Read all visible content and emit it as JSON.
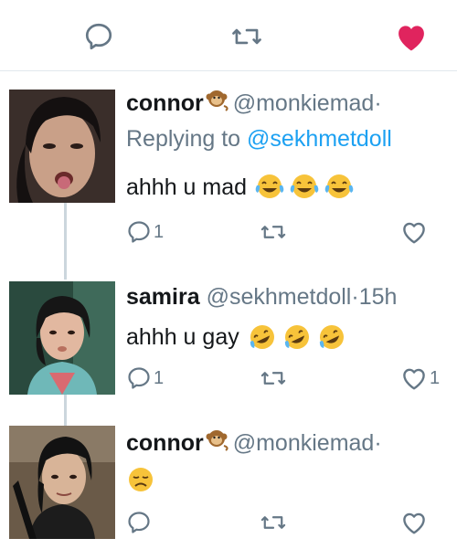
{
  "top_actions": {
    "reply_icon": "reply-icon",
    "retweet_icon": "retweet-icon",
    "like_icon": "heart-filled-icon",
    "like_color": "#e0245e"
  },
  "tweets": [
    {
      "name": "connor",
      "handle": "@monkiemad",
      "separator": "·",
      "time": "",
      "replying_prefix": "Replying to",
      "replying_to": "@sekhmetdoll",
      "text": "ahhh u mad",
      "emoji": "face-with-tears-of-joy",
      "reply_count": "1",
      "like_count": ""
    },
    {
      "name": "samira",
      "handle": "@sekhmetdoll",
      "separator": "·",
      "time": "15h",
      "text": "ahhh u gay",
      "emoji": "rolling-on-floor-laughing",
      "reply_count": "1",
      "like_count": "1"
    },
    {
      "name": "connor",
      "handle": "@monkiemad",
      "separator": "·",
      "time": "",
      "text": "",
      "emoji": "disappointed-face",
      "reply_count": "",
      "like_count": ""
    }
  ],
  "colors": {
    "secondary": "#657786",
    "link": "#1da1f2",
    "divider": "#e1e8ed",
    "thread": "#ccd6dd"
  }
}
